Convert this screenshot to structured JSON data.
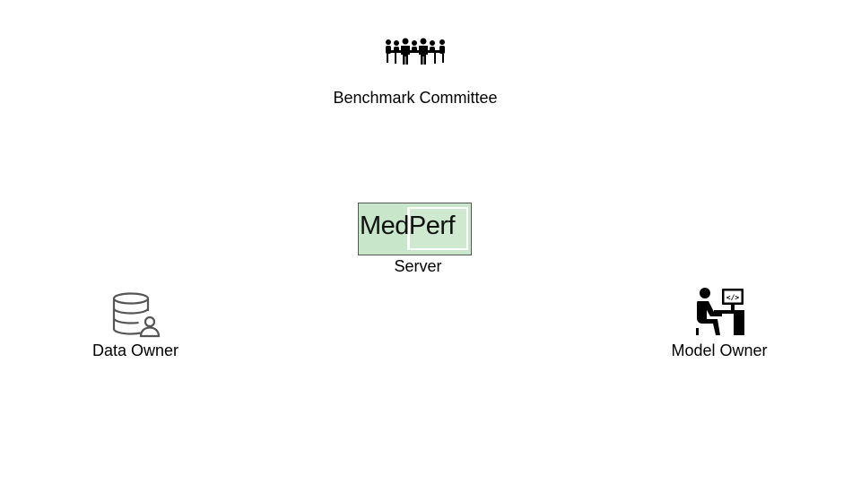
{
  "committee": {
    "label": "Benchmark Committee",
    "icon": "committee-meeting-icon"
  },
  "server": {
    "logo_text": "MedPerf",
    "label": "Server",
    "logo_bg": "#c8e6c9"
  },
  "data_owner": {
    "label": "Data Owner",
    "icon": "database-user-icon"
  },
  "model_owner": {
    "label": "Model Owner",
    "icon": "developer-at-computer-icon"
  }
}
